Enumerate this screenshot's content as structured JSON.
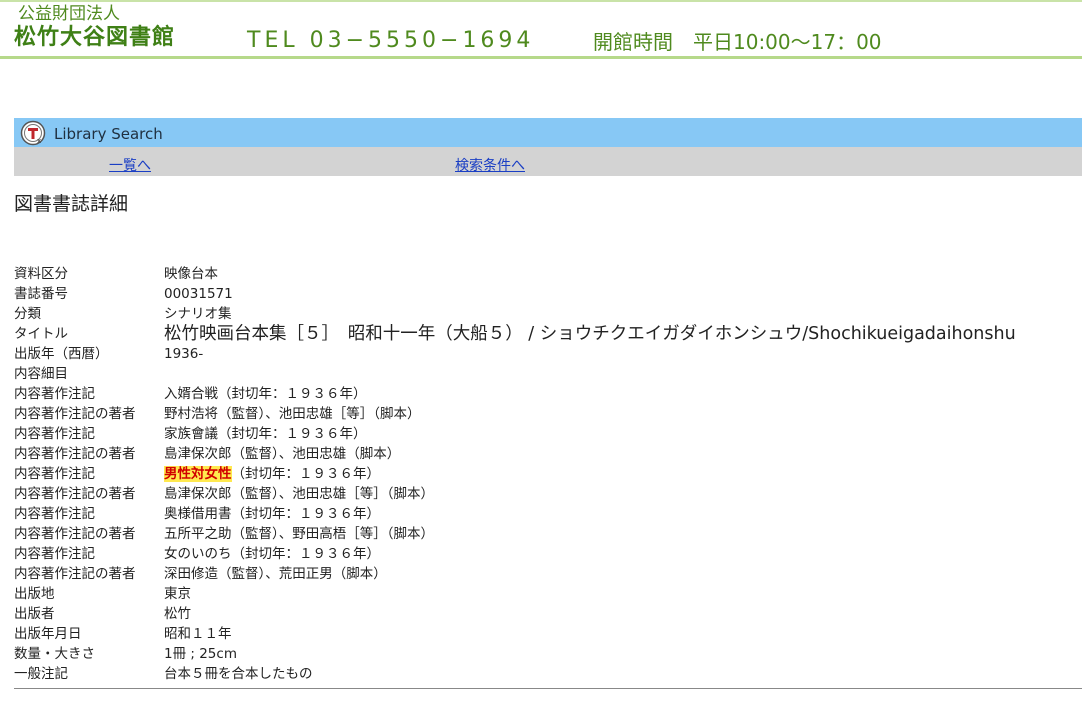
{
  "header": {
    "org_type": "公益財団法人",
    "org_name": "松竹大谷図書館",
    "tel": "TEL 03−5550−1694",
    "hours": "開館時間　平日10:00〜17：00"
  },
  "search_bar": {
    "label": "Library Search",
    "icon": "library-search-logo-icon"
  },
  "nav": {
    "list_link": "一覧へ",
    "conditions_link": "検索条件へ"
  },
  "page_title": "図書書誌詳細",
  "colors": {
    "header_green": "#4f8a1e",
    "search_bar_blue": "#87c8f5",
    "nav_gray": "#d3d3d3",
    "link_blue": "#1a3ec4",
    "highlight_bg": "#ffe94f",
    "highlight_fg": "#d10000"
  },
  "detail": [
    {
      "label": "資料区分",
      "value": "映像台本"
    },
    {
      "label": "書誌番号",
      "value": "00031571"
    },
    {
      "label": "分類",
      "value": "シナリオ集"
    },
    {
      "label": "タイトル",
      "value": "松竹映画台本集［５］　昭和十一年（大船５） / ショウチクエイガダイホンシュウ/Shochikueigadaihonshu"
    },
    {
      "label": "出版年（西暦）",
      "value": "1936-"
    },
    {
      "label": "内容細目",
      "value": ""
    },
    {
      "label": "内容著作注記",
      "value": "入婿合戦（封切年：１９３６年）"
    },
    {
      "label": "内容著作注記の著者",
      "value": "野村浩将（監督）、池田忠雄［等］（脚本）"
    },
    {
      "label": "内容著作注記",
      "value": "家族會議（封切年：１９３６年）"
    },
    {
      "label": "内容著作注記の著者",
      "value": "島津保次郎（監督）、池田忠雄（脚本）"
    },
    {
      "label": "内容著作注記",
      "value_highlight": "男性対女性",
      "value": "（封切年：１９３６年）"
    },
    {
      "label": "内容著作注記の著者",
      "value": "島津保次郎（監督）、池田忠雄［等］（脚本）"
    },
    {
      "label": "内容著作注記",
      "value": "奥様借用書（封切年：１９３６年）"
    },
    {
      "label": "内容著作注記の著者",
      "value": "五所平之助（監督）、野田高梧［等］（脚本）"
    },
    {
      "label": "内容著作注記",
      "value": "女のいのち（封切年：１９３６年）"
    },
    {
      "label": "内容著作注記の著者",
      "value": "深田修造（監督）、荒田正男（脚本）"
    },
    {
      "label": "出版地",
      "value": "東京"
    },
    {
      "label": "出版者",
      "value": "松竹"
    },
    {
      "label": "出版年月日",
      "value": "昭和１１年"
    },
    {
      "label": "数量・大きさ",
      "value": "1冊 ; 25cm"
    },
    {
      "label": "一般注記",
      "value": "台本５冊を合本したもの"
    }
  ]
}
